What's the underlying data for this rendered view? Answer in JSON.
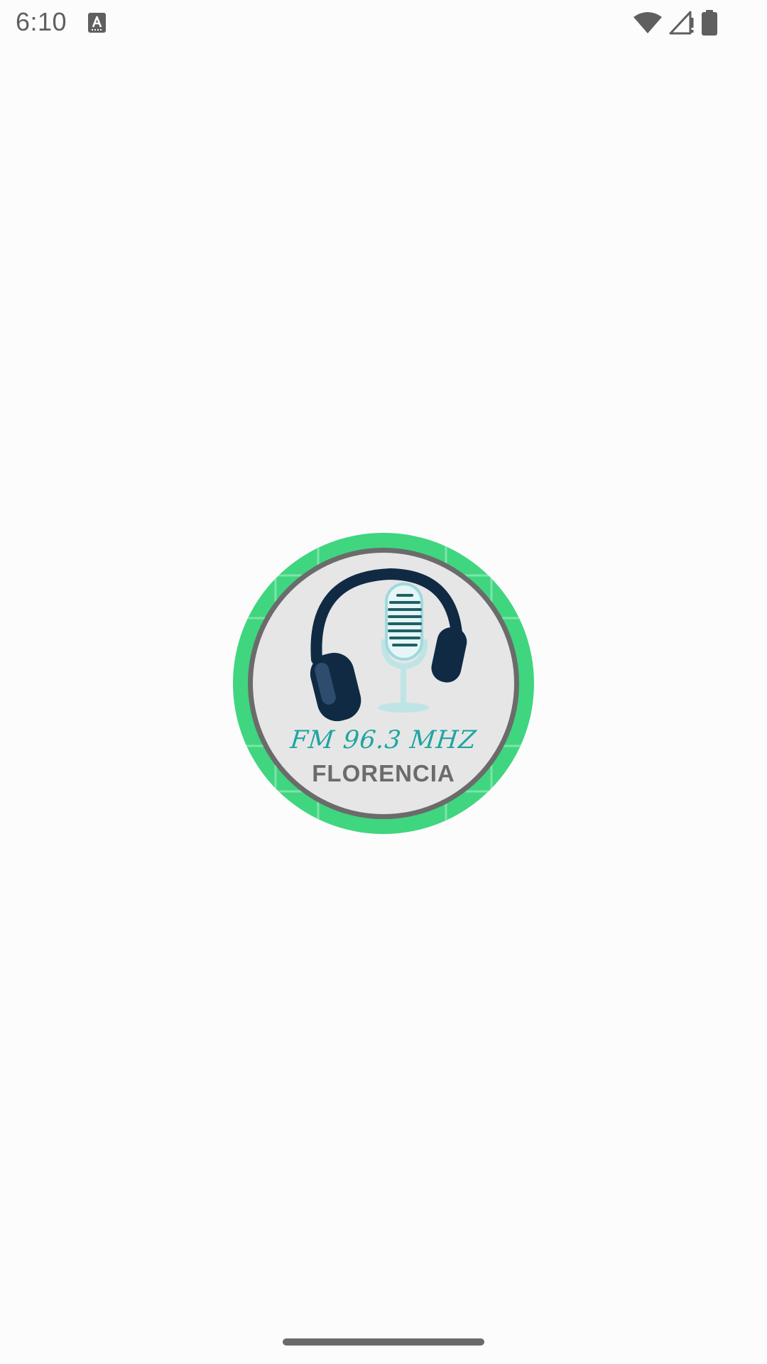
{
  "status_bar": {
    "time": "6:10",
    "icons": [
      "keyboard-a-icon",
      "wifi-icon",
      "cell-signal-icon",
      "battery-icon"
    ],
    "icon_color": "#5f5f5f"
  },
  "splash": {
    "logo": {
      "line1": "FM 96.3 MHZ",
      "line2": "FLORENCIA",
      "ring_color": "#3fd67f",
      "inner_ring_color": "#6b6b6b",
      "face_color": "#e6e6e7",
      "headphone_color": "#102a44",
      "mic_color": "#9fd9dc",
      "line1_color": "#1fa5a0",
      "line2_color": "#6b6b6b"
    }
  },
  "background_color": "#fcfcfc"
}
